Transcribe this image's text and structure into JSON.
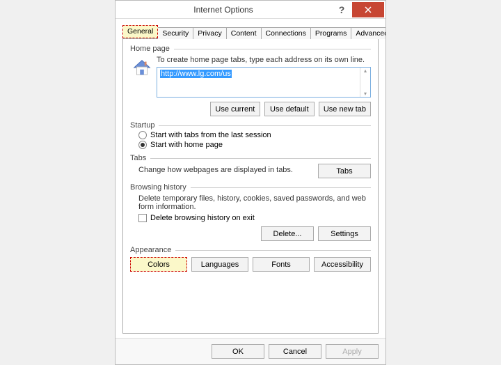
{
  "title": "Internet Options",
  "tabs": [
    "General",
    "Security",
    "Privacy",
    "Content",
    "Connections",
    "Programs",
    "Advanced"
  ],
  "homepage": {
    "legend": "Home page",
    "desc": "To create home page tabs, type each address on its own line.",
    "url": "http://www.lg.com/us",
    "use_current": "Use current",
    "use_default": "Use default",
    "use_new_tab": "Use new tab"
  },
  "startup": {
    "legend": "Startup",
    "opt_last": "Start with tabs from the last session",
    "opt_home": "Start with home page"
  },
  "tabs_section": {
    "legend": "Tabs",
    "desc": "Change how webpages are displayed in tabs.",
    "btn": "Tabs"
  },
  "history": {
    "legend": "Browsing history",
    "desc": "Delete temporary files, history, cookies, saved passwords, and web form information.",
    "check": "Delete browsing history on exit",
    "delete_btn": "Delete...",
    "settings_btn": "Settings"
  },
  "appearance": {
    "legend": "Appearance",
    "colors": "Colors",
    "languages": "Languages",
    "fonts": "Fonts",
    "accessibility": "Accessibility"
  },
  "footer": {
    "ok": "OK",
    "cancel": "Cancel",
    "apply": "Apply"
  }
}
